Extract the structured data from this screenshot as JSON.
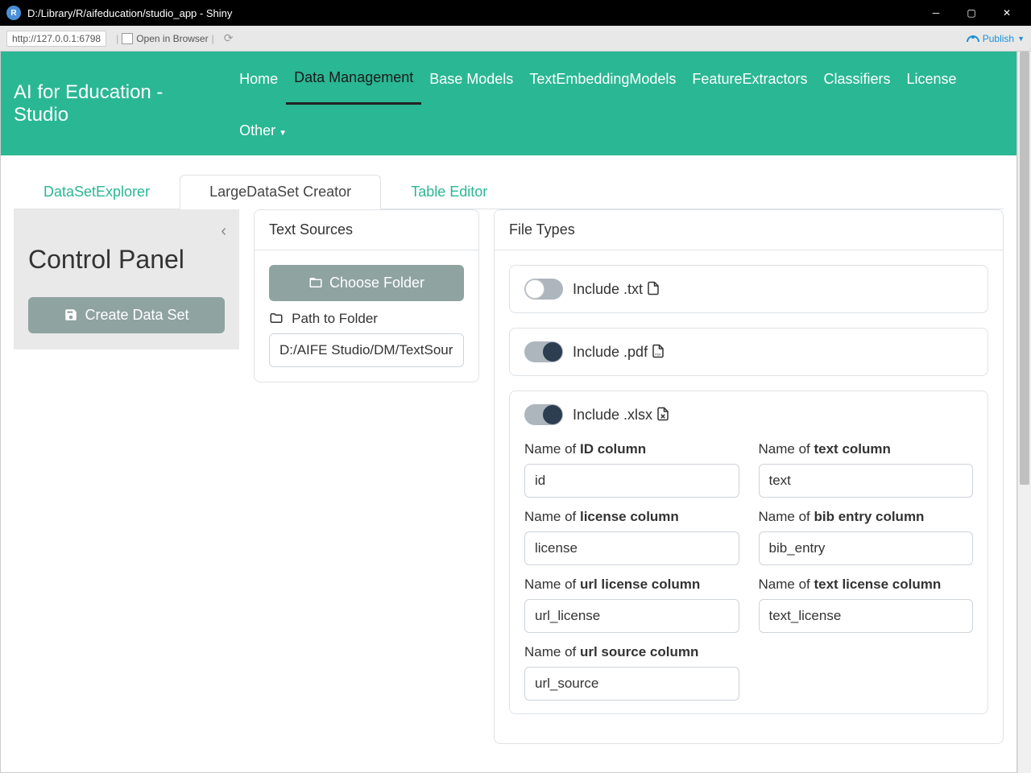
{
  "window": {
    "title": "D:/Library/R/aifeducation/studio_app - Shiny",
    "app_letter": "R"
  },
  "toolbar": {
    "url": "http://127.0.0.1:6798",
    "open_browser": "Open in Browser",
    "publish": "Publish"
  },
  "navbar": {
    "brand": "AI for Education - Studio",
    "items": [
      "Home",
      "Data Management",
      "Base Models",
      "TextEmbeddingModels",
      "FeatureExtractors",
      "Classifiers",
      "License",
      "Other"
    ],
    "active_index": 1
  },
  "tabs": {
    "items": [
      "DataSetExplorer",
      "LargeDataSet Creator",
      "Table Editor"
    ],
    "active_index": 1
  },
  "sidebar": {
    "heading": "Control Panel",
    "create_btn": "Create Data Set"
  },
  "sources": {
    "title": "Text Sources",
    "choose_btn": "Choose Folder",
    "path_label": "Path to Folder",
    "path_value": "D:/AIFE Studio/DM/TextSources"
  },
  "filetypes": {
    "title": "File Types",
    "txt": {
      "label": "Include .txt",
      "on": false
    },
    "pdf": {
      "label": "Include .pdf",
      "on": true
    },
    "xlsx": {
      "label": "Include .xlsx",
      "on": true,
      "fields": {
        "id": {
          "pre": "Name of ",
          "bold": "ID column",
          "value": "id"
        },
        "text": {
          "pre": "Name of ",
          "bold": "text column",
          "value": "text"
        },
        "license": {
          "pre": "Name of ",
          "bold": "license column",
          "value": "license"
        },
        "bib": {
          "pre": "Name of ",
          "bold": "bib entry column",
          "value": "bib_entry"
        },
        "url_license": {
          "pre": "Name of ",
          "bold": "url license column",
          "value": "url_license"
        },
        "text_license": {
          "pre": "Name of ",
          "bold": "text license column",
          "value": "text_license"
        },
        "url_source": {
          "pre": "Name of ",
          "bold": "url source column",
          "value": "url_source"
        }
      }
    }
  }
}
